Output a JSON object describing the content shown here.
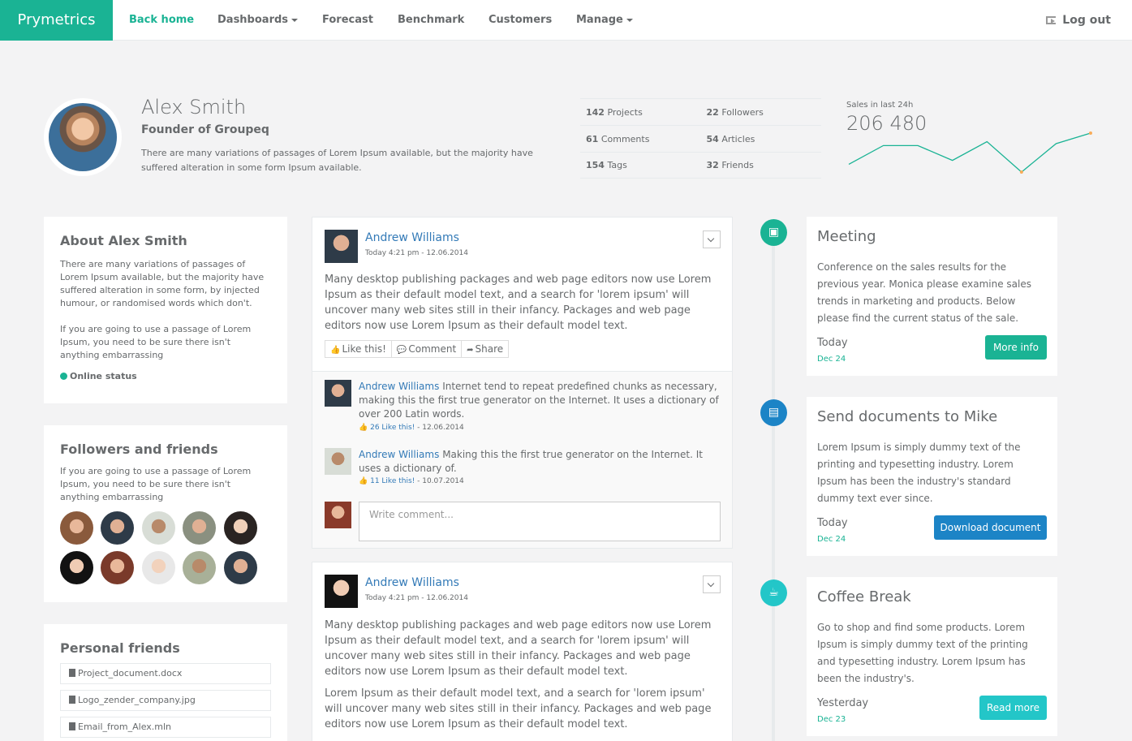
{
  "nav": {
    "brand": "Prymetrics",
    "items": [
      {
        "label": "Back home"
      },
      {
        "label": "Dashboards"
      },
      {
        "label": "Forecast"
      },
      {
        "label": "Benchmark"
      },
      {
        "label": "Customers"
      },
      {
        "label": "Manage"
      }
    ],
    "logout": "Log out"
  },
  "profile": {
    "name": "Alex Smith",
    "role": "Founder of Groupeq",
    "description": "There are many variations of passages of Lorem Ipsum available, but the majority have suffered alteration in some form Ipsum available.",
    "stats": [
      {
        "value": "142",
        "label": "Projects"
      },
      {
        "value": "22",
        "label": "Followers"
      },
      {
        "value": "61",
        "label": "Comments"
      },
      {
        "value": "54",
        "label": "Articles"
      },
      {
        "value": "154",
        "label": "Tags"
      },
      {
        "value": "32",
        "label": "Friends"
      }
    ],
    "sales_label": "Sales in last 24h",
    "sales_value": "206 480",
    "sparkline": [
      0.2,
      0.68,
      0.68,
      0.3,
      0.78,
      0.0,
      0.73,
      1.0
    ],
    "accent_color": "#1ab394"
  },
  "about": {
    "title": "About Alex Smith",
    "para1": "There are many variations of passages of Lorem Ipsum available, but the majority have suffered alteration in some form, by injected humour, or randomised words which don't.",
    "para2": "If you are going to use a passage of Lorem Ipsum, you need to be sure there isn't anything embarrassing",
    "status": "Online status"
  },
  "followers": {
    "title": "Followers and friends",
    "text": "If you are going to use a passage of Lorem Ipsum, you need to be sure there isn't anything embarrassing"
  },
  "personal": {
    "title": "Personal friends",
    "files": [
      "Project_document.docx",
      "Logo_zender_company.jpg",
      "Email_from_Alex.mln"
    ]
  },
  "post1": {
    "author": "Andrew Williams",
    "date": "Today 4:21 pm - 12.06.2014",
    "text": "Many desktop publishing packages and web page editors now use Lorem Ipsum as their default model text, and a search for 'lorem ipsum' will uncover many web sites still in their infancy. Packages and web page editors now use Lorem Ipsum as their default model text.",
    "like": "Like this!",
    "comment": "Comment",
    "share": "Share",
    "comments": [
      {
        "author": "Andrew Williams",
        "text": "Internet tend to repeat predefined chunks as necessary, making this the first true generator on the Internet. It uses a dictionary of over 200 Latin words.",
        "likes": "26 Like this!",
        "date": "- 12.06.2014"
      },
      {
        "author": "Andrew Williams",
        "text": "Making this the first true generator on the Internet. It uses a dictionary of.",
        "likes": "11 Like this!",
        "date": "- 10.07.2014"
      }
    ],
    "write_placeholder": "Write comment..."
  },
  "post2": {
    "author": "Andrew Williams",
    "date": "Today 4:21 pm - 12.06.2014",
    "text1": "Many desktop publishing packages and web page editors now use Lorem Ipsum as their default model text, and a search for 'lorem ipsum' will uncover many web sites still in their infancy. Packages and web page editors now use Lorem Ipsum as their default model text.",
    "text2": "Lorem Ipsum as their default model text, and a search for 'lorem ipsum' will uncover many web sites still in their infancy. Packages and web page editors now use Lorem Ipsum as their default model text."
  },
  "timeline": [
    {
      "icon": "briefcase-icon",
      "title": "Meeting",
      "text": "Conference on the sales results for the previous year. Monica please examine sales trends in marketing and products. Below please find the current status of the sale.",
      "when": "Today",
      "date": "Dec 24",
      "button": "More info",
      "color": "#1ab394",
      "button_color": "#1ab394"
    },
    {
      "icon": "file-icon",
      "title": "Send documents to Mike",
      "text": "Lorem Ipsum is simply dummy text of the printing and typesetting industry. Lorem Ipsum has been the industry's standard dummy text ever since.",
      "when": "Today",
      "date": "Dec 24",
      "button": "Download document",
      "color": "#1c84c6",
      "button_color": "#1c84c6"
    },
    {
      "icon": "coffee-icon",
      "title": "Coffee Break",
      "text": "Go to shop and find some products. Lorem Ipsum is simply dummy text of the printing and typesetting industry. Lorem Ipsum has been the industry's.",
      "when": "Yesterday",
      "date": "Dec 23",
      "button": "Read more",
      "color": "#23c6c8",
      "button_color": "#23c6c8"
    }
  ]
}
